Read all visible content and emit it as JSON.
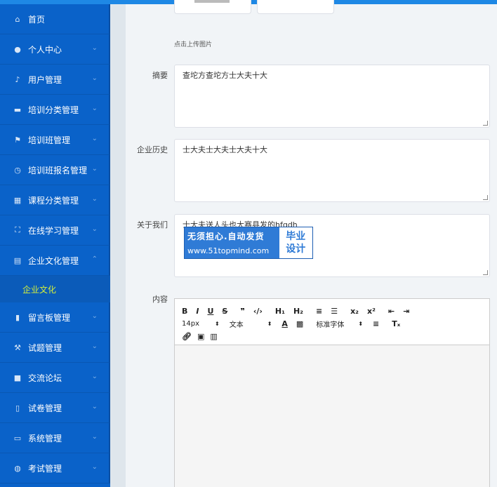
{
  "sidebar": {
    "items": [
      {
        "label": "首页",
        "icon": "home-icon"
      },
      {
        "label": "个人中心",
        "icon": "user-icon"
      },
      {
        "label": "用户管理",
        "icon": "microphone-icon"
      },
      {
        "label": "培训分类管理",
        "icon": "briefcase-icon"
      },
      {
        "label": "培训班管理",
        "icon": "flag-icon"
      },
      {
        "label": "培训班报名管理",
        "icon": "clock-icon"
      },
      {
        "label": "课程分类管理",
        "icon": "grid-icon"
      },
      {
        "label": "在线学习管理",
        "icon": "expand-icon"
      },
      {
        "label": "企业文化管理",
        "icon": "document-icon"
      },
      {
        "label": "留言板管理",
        "icon": "bar-chart-icon"
      },
      {
        "label": "试题管理",
        "icon": "gavel-icon"
      },
      {
        "label": "交流论坛",
        "icon": "camera-icon"
      },
      {
        "label": "试卷管理",
        "icon": "mobile-icon"
      },
      {
        "label": "系统管理",
        "icon": "monitor-icon"
      },
      {
        "label": "考试管理",
        "icon": "globe-icon"
      }
    ],
    "submenu": {
      "label": "企业文化"
    }
  },
  "form": {
    "upload_tip": "点击上传图片",
    "summary": {
      "label": "摘要",
      "value": "查坨方查坨方士大夫十大"
    },
    "history": {
      "label": "企业历史",
      "value": "士大夫士大夫士大夫十大"
    },
    "about": {
      "label": "关于我们",
      "value": "士大夫送人头也大赛县发的hfgdh"
    },
    "content": {
      "label": "内容"
    }
  },
  "editor": {
    "font_size": "14px",
    "block_type": "文本",
    "font_family": "标准字体"
  },
  "watermark": {
    "line1": "无须担心.自动发货",
    "line2": "www.51topmind.com",
    "badge1": "毕业",
    "badge2": "设计"
  }
}
